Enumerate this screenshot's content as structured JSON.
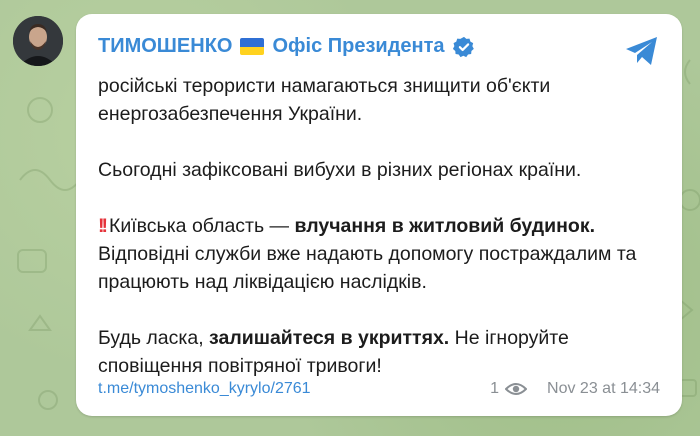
{
  "channel": {
    "name_part1": "ТИМОШЕНКО",
    "name_part2": "Офіс Президента",
    "flag_colors": [
      "#2f6fd4",
      "#ffd21f"
    ],
    "accent": "#3a8ad6",
    "verified_icon": "verified-check-icon",
    "share_icon": "telegram-share-icon"
  },
  "message": {
    "p1": "російські терористи намагаються знищити об'єкти енергозабезпечення України.",
    "p2": "Сьогодні зафіксовані вибухи в різних регіонах країни.",
    "p3_alarm": "!!",
    "p3_a": "Київська область — ",
    "p3_bold": "влучання в житловий будинок.",
    "p3_b": " Відповідні служби вже надають допомогу постраждалим та працюють над ліквідацією наслідків.",
    "p4_a": "Будь ласка, ",
    "p4_bold": "залишайтеся в укриттях.",
    "p4_b": " Не ігноруйте сповіщення повітряної тривоги!"
  },
  "footer": {
    "link": "t.me/tymoshenko_kyrylo/2761",
    "views": "1",
    "timestamp": "Nov 23 at 14:34"
  }
}
